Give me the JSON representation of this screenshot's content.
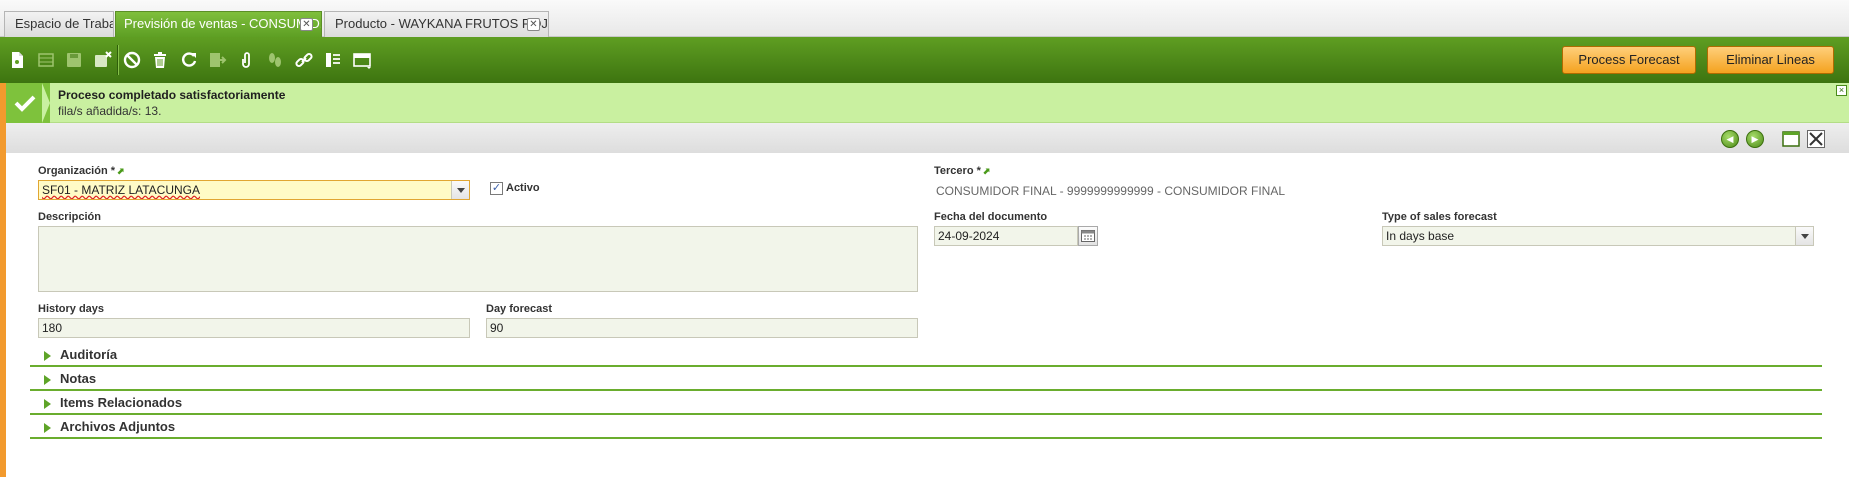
{
  "tabs": [
    {
      "label": "Espacio de Trabajo",
      "active": false,
      "closable": false
    },
    {
      "label": "Previsión de ventas - CONSUMID...",
      "active": true,
      "closable": true
    },
    {
      "label": "Producto - WAYKANA FRUTOS ROJO...",
      "active": false,
      "closable": true
    }
  ],
  "toolbar": {
    "icons": [
      "new-document-icon",
      "grid-icon",
      "save-icon",
      "save-close-icon",
      "undo-icon",
      "delete-icon",
      "refresh-icon",
      "export-icon",
      "attach-icon",
      "audit-icon",
      "link-icon",
      "tools-icon",
      "view-switch-icon"
    ],
    "process_forecast_label": "Process Forecast",
    "eliminar_lineas_label": "Eliminar Lineas"
  },
  "message": {
    "title": "Proceso completado satisfactoriamente",
    "text": "fila/s añadida/s: 13.",
    "close": "×"
  },
  "form": {
    "organizacion": {
      "label": "Organización *",
      "value": "SF01 - MATRIZ LATACUNGA"
    },
    "activo": {
      "label": "Activo",
      "checked": true
    },
    "tercero": {
      "label": "Tercero *",
      "value": "CONSUMIDOR FINAL - 9999999999999 - CONSUMIDOR FINAL"
    },
    "descripcion": {
      "label": "Descripción",
      "value": ""
    },
    "fecha": {
      "label": "Fecha del documento",
      "value": "24-09-2024"
    },
    "type_forecast": {
      "label": "Type of sales forecast",
      "value": "In days base"
    },
    "history_days": {
      "label": "History days",
      "value": "180"
    },
    "day_forecast": {
      "label": "Day forecast",
      "value": "90"
    }
  },
  "sections": [
    {
      "title": "Auditoría"
    },
    {
      "title": "Notas"
    },
    {
      "title": "Items Relacionados"
    },
    {
      "title": "Archivos Adjuntos"
    }
  ],
  "colors": {
    "toolbar_green": "#4e8a18",
    "message_bg": "#c9f0a0",
    "action_orange": "#f4a21f",
    "left_accent": "#f29a2e"
  }
}
